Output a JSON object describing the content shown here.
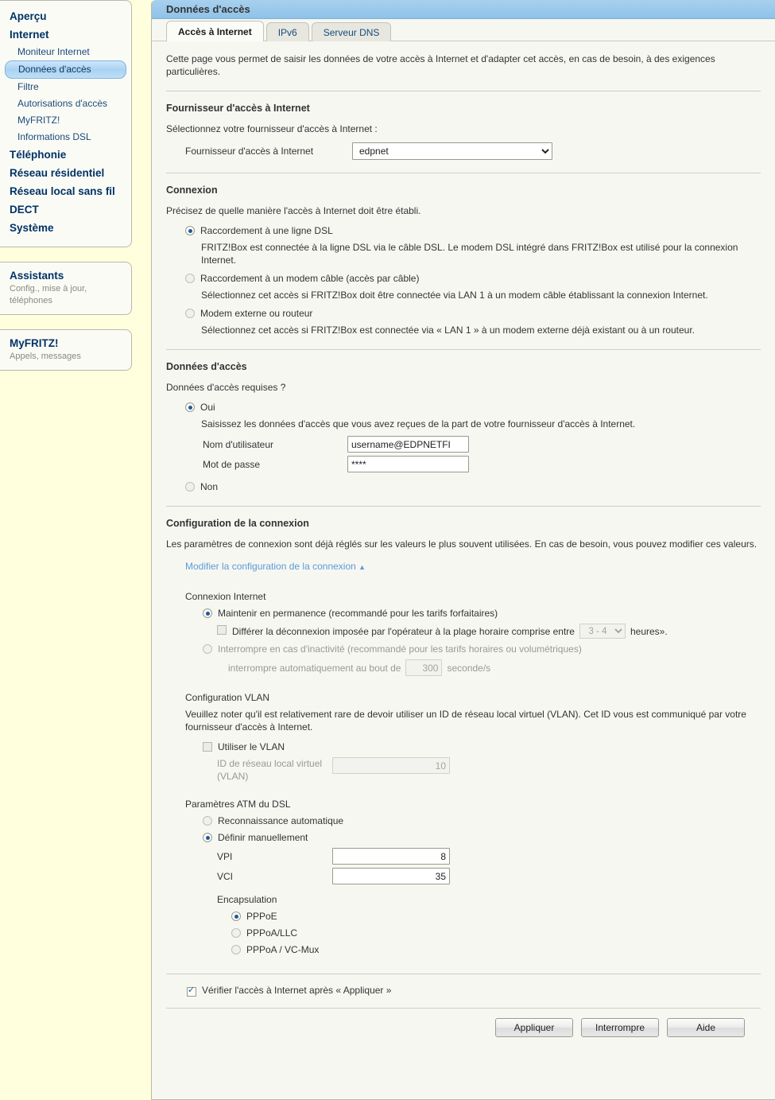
{
  "sidebar": {
    "nav": [
      {
        "label": "Aperçu",
        "level": "top",
        "selected": false
      },
      {
        "label": "Internet",
        "level": "top",
        "selected": false
      },
      {
        "label": "Moniteur Internet",
        "level": "sub",
        "selected": false
      },
      {
        "label": "Données d'accès",
        "level": "sub",
        "selected": true
      },
      {
        "label": "Filtre",
        "level": "sub",
        "selected": false
      },
      {
        "label": "Autorisations d'accès",
        "level": "sub",
        "selected": false
      },
      {
        "label": "MyFRITZ!",
        "level": "sub",
        "selected": false
      },
      {
        "label": "Informations DSL",
        "level": "sub",
        "selected": false
      },
      {
        "label": "Téléphonie",
        "level": "top",
        "selected": false
      },
      {
        "label": "Réseau résidentiel",
        "level": "top",
        "selected": false
      },
      {
        "label": "Réseau local sans fil",
        "level": "top",
        "selected": false
      },
      {
        "label": "DECT",
        "level": "top",
        "selected": false
      },
      {
        "label": "Système",
        "level": "top",
        "selected": false
      }
    ],
    "assistants": {
      "title": "Assistants",
      "subtitle": "Config., mise à jour, téléphones"
    },
    "myfritz": {
      "title": "MyFRITZ!",
      "subtitle": "Appels, messages"
    }
  },
  "header": {
    "title": "Données d'accès"
  },
  "tabs": [
    {
      "label": "Accès à Internet",
      "active": true
    },
    {
      "label": "IPv6",
      "active": false
    },
    {
      "label": "Serveur DNS",
      "active": false
    }
  ],
  "intro": "Cette page vous permet de saisir les données de votre accès à Internet et d'adapter cet accès, en cas de besoin, à des exigences particulières.",
  "isp_section": {
    "title": "Fournisseur d'accès à Internet",
    "prompt": "Sélectionnez votre fournisseur d'accès à Internet :",
    "field_label": "Fournisseur d'accès à Internet",
    "selected_value": "edpnet"
  },
  "connexion_section": {
    "title": "Connexion",
    "prompt": "Précisez de quelle manière l'accès à Internet doit être établi.",
    "options": [
      {
        "label": "Raccordement à une ligne DSL",
        "selected": true,
        "description": "FRITZ!Box est connectée à la ligne DSL via le câble DSL. Le modem DSL intégré dans FRITZ!Box est utilisé pour la connexion Internet."
      },
      {
        "label": "Raccordement à un modem câble (accès par câble)",
        "selected": false,
        "description": "Sélectionnez cet accès si FRITZ!Box doit être connectée via LAN 1 à un modem câble établissant la connexion Internet."
      },
      {
        "label": "Modem externe ou routeur",
        "selected": false,
        "description": "Sélectionnez cet accès si FRITZ!Box est connectée via « LAN 1 » à un modem externe déjà existant ou à un routeur."
      }
    ]
  },
  "credentials_section": {
    "title": "Données d'accès",
    "prompt": "Données d'accès requises ?",
    "yes_label": "Oui",
    "yes_selected": true,
    "hint": "Saisissez les données d'accès que vous avez reçues de la part de votre fournisseur d'accès à Internet.",
    "username_label": "Nom d'utilisateur",
    "username_value": "username@EDPNETFI",
    "password_label": "Mot de passe",
    "password_value": "****",
    "no_label": "Non",
    "no_selected": false
  },
  "conn_config_section": {
    "title": "Configuration de la connexion",
    "intro": "Les paramètres de connexion sont déjà réglés sur les valeurs le plus souvent utilisées. En cas de besoin, vous pouvez modifier ces valeurs.",
    "toggle_link": "Modifier la configuration de la connexion",
    "toggle_icon": "▲",
    "internet_conn_label": "Connexion Internet",
    "permanent": {
      "label": "Maintenir en permanence (recommandé pour les tarifs forfaitaires)",
      "selected": true
    },
    "defer": {
      "checked": false,
      "text_before": "Différer la déconnexion imposée par l'opérateur à la plage horaire comprise entre",
      "range_value": "3 - 4",
      "text_after": "heures»."
    },
    "inactivity": {
      "label": "Interrompre en cas d'inactivité (recommandé pour les tarifs horaires ou volumétriques)",
      "selected": false,
      "text_before": "interrompre automatiquement au bout de",
      "seconds_value": "300",
      "text_after": "seconde/s"
    }
  },
  "vlan_section": {
    "title": "Configuration VLAN",
    "note": "Veuillez noter qu'il est relativement rare de devoir utiliser un ID de réseau local virtuel (VLAN). Cet ID vous est communiqué par votre fournisseur d'accès à Internet.",
    "use_vlan_label": "Utiliser le VLAN",
    "use_vlan_checked": false,
    "vlan_id_label": "ID de réseau local virtuel (VLAN)",
    "vlan_id_value": "10"
  },
  "atm_section": {
    "title": "Paramètres ATM du DSL",
    "auto_label": "Reconnaissance automatique",
    "auto_selected": false,
    "manual_label": "Définir manuellement",
    "manual_selected": true,
    "vpi_label": "VPI",
    "vpi_value": "8",
    "vci_label": "VCI",
    "vci_value": "35",
    "encapsulation_label": "Encapsulation",
    "encapsulation_options": [
      {
        "label": "PPPoE",
        "selected": true
      },
      {
        "label": "PPPoA/LLC",
        "selected": false
      },
      {
        "label": "PPPoA / VC-Mux",
        "selected": false
      }
    ]
  },
  "footer": {
    "verify_label": "Vérifier l'accès à Internet après « Appliquer »",
    "verify_checked": true,
    "buttons": {
      "apply": "Appliquer",
      "cancel": "Interrompre",
      "help": "Aide"
    }
  },
  "colors": {
    "page_bg": "#ffffdd",
    "panel_bg": "#f7f7f2",
    "title_blue": "#8fc2e8",
    "link_blue": "#5a9bd8",
    "nav_selected": "#a9d2f2"
  }
}
